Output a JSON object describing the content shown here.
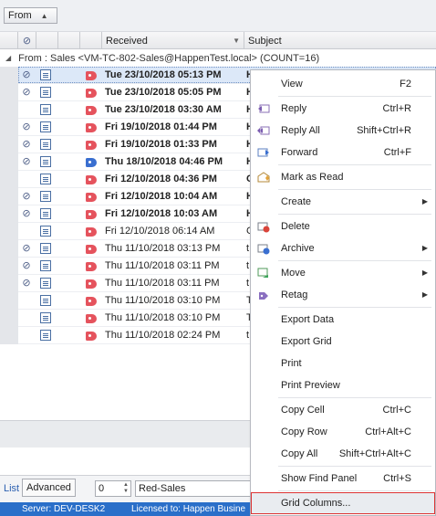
{
  "groupby": {
    "field": "From"
  },
  "columns": {
    "received": "Received",
    "subject": "Subject"
  },
  "group_row": {
    "text": "From : Sales <VM-TC-802-Sales@HappenTest.local> (COUNT=16)"
  },
  "colors": {
    "accent": "#2a6fc9",
    "tag_red": "#e5535d",
    "tag_blue": "#3a6fd0",
    "highlight_border": "#dd3333"
  },
  "rows": [
    {
      "date": "Tue 23/10/2018 05:13 PM",
      "subject": "H",
      "bold": true,
      "att": true,
      "tag": "red",
      "selected": true
    },
    {
      "date": "Tue 23/10/2018 05:05 PM",
      "subject": "H",
      "bold": true,
      "att": true,
      "tag": "red"
    },
    {
      "date": "Tue 23/10/2018 03:30 AM",
      "subject": "H",
      "bold": true,
      "att": false,
      "tag": "red"
    },
    {
      "date": "Fri 19/10/2018 01:44 PM",
      "subject": "H",
      "bold": true,
      "att": true,
      "tag": "red"
    },
    {
      "date": "Fri 19/10/2018 01:33 PM",
      "subject": "H",
      "bold": true,
      "att": true,
      "tag": "red"
    },
    {
      "date": "Thu 18/10/2018 04:46 PM",
      "subject": "H",
      "bold": true,
      "att": true,
      "tag": "blue"
    },
    {
      "date": "Fri 12/10/2018 04:36 PM",
      "subject": "C",
      "bold": true,
      "att": false,
      "tag": "red"
    },
    {
      "date": "Fri 12/10/2018 10:04 AM",
      "subject": "H",
      "bold": true,
      "att": true,
      "tag": "red"
    },
    {
      "date": "Fri 12/10/2018 10:03 AM",
      "subject": "H",
      "bold": true,
      "att": true,
      "tag": "red"
    },
    {
      "date": "Fri 12/10/2018 06:14 AM",
      "subject": "C",
      "bold": false,
      "att": false,
      "tag": "red"
    },
    {
      "date": "Thu 11/10/2018 03:13 PM",
      "subject": "t",
      "bold": false,
      "att": true,
      "tag": "red"
    },
    {
      "date": "Thu 11/10/2018 03:11 PM",
      "subject": "t",
      "bold": false,
      "att": true,
      "tag": "red"
    },
    {
      "date": "Thu 11/10/2018 03:11 PM",
      "subject": "t",
      "bold": false,
      "att": true,
      "tag": "red"
    },
    {
      "date": "Thu 11/10/2018 03:10 PM",
      "subject": "T",
      "bold": false,
      "att": false,
      "tag": "red"
    },
    {
      "date": "Thu 11/10/2018 03:10 PM",
      "subject": "T",
      "bold": false,
      "att": false,
      "tag": "red"
    },
    {
      "date": "Thu 11/10/2018 02:24 PM",
      "subject": "t",
      "bold": false,
      "att": false,
      "tag": "red"
    }
  ],
  "bottom": {
    "tab_list": "List",
    "tab_advanced": "Advanced",
    "stepper_value": "0",
    "combo_value": "Red-Sales",
    "status_server": "Server: DEV-DESK2",
    "status_license": "Licensed to: Happen Busine"
  },
  "menu": {
    "view": {
      "label": "View",
      "shortcut": "F2"
    },
    "reply": {
      "label": "Reply",
      "shortcut": "Ctrl+R",
      "icon": "reply-icon"
    },
    "reply_all": {
      "label": "Reply All",
      "shortcut": "Shift+Ctrl+R",
      "icon": "reply-all-icon"
    },
    "forward": {
      "label": "Forward",
      "shortcut": "Ctrl+F",
      "icon": "forward-icon"
    },
    "mark_read": {
      "label": "Mark as Read",
      "icon": "mark-read-icon"
    },
    "create": {
      "label": "Create"
    },
    "delete": {
      "label": "Delete",
      "icon": "delete-icon"
    },
    "archive": {
      "label": "Archive",
      "icon": "archive-icon"
    },
    "move": {
      "label": "Move",
      "icon": "move-icon"
    },
    "retag": {
      "label": "Retag",
      "icon": "retag-icon"
    },
    "export_data": {
      "label": "Export Data"
    },
    "export_grid": {
      "label": "Export Grid"
    },
    "print": {
      "label": "Print"
    },
    "print_preview": {
      "label": "Print Preview"
    },
    "copy_cell": {
      "label": "Copy Cell",
      "shortcut": "Ctrl+C"
    },
    "copy_row": {
      "label": "Copy Row",
      "shortcut": "Ctrl+Alt+C"
    },
    "copy_all": {
      "label": "Copy All",
      "shortcut": "Shift+Ctrl+Alt+C"
    },
    "find_panel": {
      "label": "Show Find Panel",
      "shortcut": "Ctrl+S"
    },
    "grid_columns": {
      "label": "Grid Columns..."
    }
  }
}
